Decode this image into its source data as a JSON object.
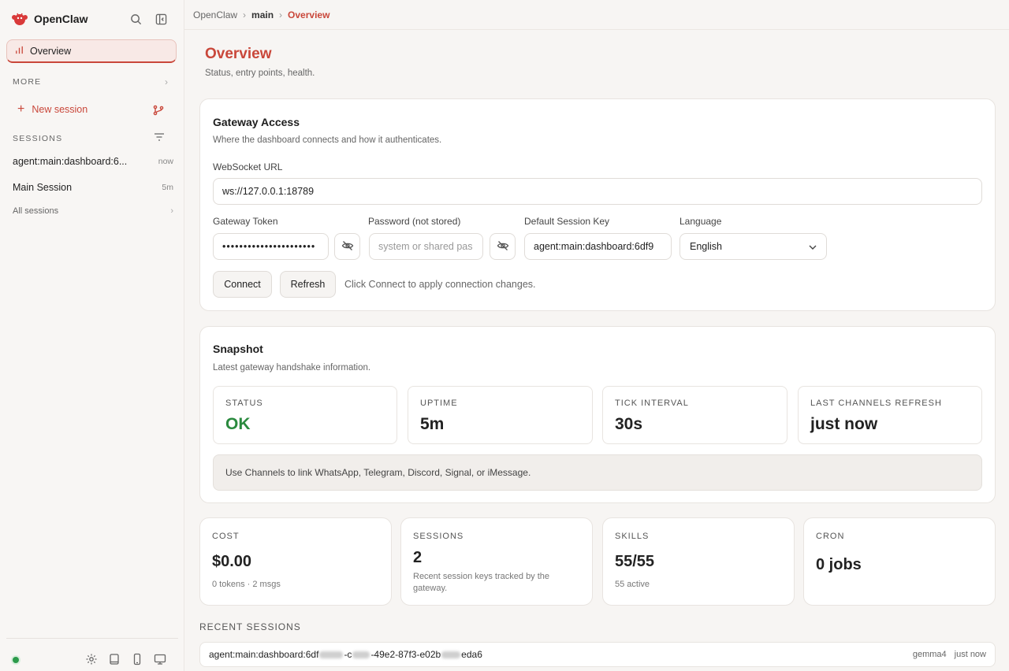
{
  "sidebar": {
    "brand": "OpenClaw",
    "overview_label": "Overview",
    "more_label": "MORE",
    "new_session_label": "New session",
    "sessions_label": "SESSIONS",
    "sessions": [
      {
        "title": "agent:main:dashboard:6...",
        "meta": "now"
      },
      {
        "title": "Main Session",
        "meta": "5m"
      }
    ],
    "all_sessions_label": "All sessions"
  },
  "breadcrumb": [
    "OpenClaw",
    "main",
    "Overview"
  ],
  "page": {
    "title": "Overview",
    "subtitle": "Status, entry points, health."
  },
  "gateway": {
    "title": "Gateway Access",
    "subtitle": "Where the dashboard connects and how it authenticates.",
    "ws_label": "WebSocket URL",
    "ws_value": "ws://127.0.0.1:18789",
    "token_label": "Gateway Token",
    "token_value": "••••••••••••••••••••••",
    "password_label": "Password (not stored)",
    "password_placeholder": "system or shared pas",
    "session_key_label": "Default Session Key",
    "session_key_value": "agent:main:dashboard:6df9",
    "language_label": "Language",
    "language_value": "English",
    "connect_label": "Connect",
    "refresh_label": "Refresh",
    "hint": "Click Connect to apply connection changes."
  },
  "snapshot": {
    "title": "Snapshot",
    "subtitle": "Latest gateway handshake information.",
    "stats": [
      {
        "key": "STATUS",
        "value": "OK"
      },
      {
        "key": "UPTIME",
        "value": "5m"
      },
      {
        "key": "TICK INTERVAL",
        "value": "30s"
      },
      {
        "key": "LAST CHANNELS REFRESH",
        "value": "just now"
      }
    ],
    "notice": "Use Channels to link WhatsApp, Telegram, Discord, Signal, or iMessage."
  },
  "metrics": [
    {
      "key": "COST",
      "value": "$0.00",
      "detail": "0 tokens · 2 msgs"
    },
    {
      "key": "SESSIONS",
      "value": "2",
      "detail": "Recent session keys tracked by the gateway."
    },
    {
      "key": "SKILLS",
      "value": "55/55",
      "detail": "55 active"
    },
    {
      "key": "CRON",
      "value": "0 jobs",
      "detail": ""
    }
  ],
  "recent": {
    "heading": "RECENT SESSIONS",
    "row": {
      "key_parts": [
        "agent:main:dashboard:6df",
        "-c",
        "-49e2-87f3-e02b",
        "eda6"
      ],
      "model": "gemma4",
      "time": "just now"
    }
  },
  "colors": {
    "accent": "#c9473a",
    "ok": "#2a8a3e"
  }
}
